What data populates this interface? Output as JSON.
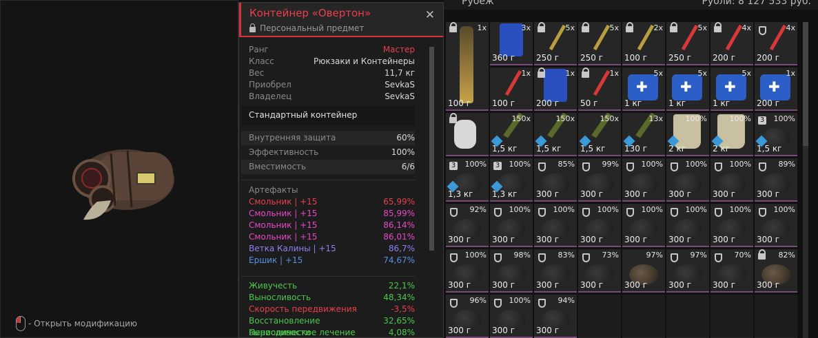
{
  "header": {
    "location": "Рубеж",
    "money": "Рубли: 8 127 533 руб."
  },
  "hint": {
    "text": "- Открыть модификацию"
  },
  "panel": {
    "title": "Контейнер «Овертон»",
    "subtitle": "Персональный предмет",
    "close": "✕",
    "info": [
      {
        "k": "Ранг",
        "v": "Мастер",
        "color": "#e8404c"
      },
      {
        "k": "Класс",
        "v": "Рюкзаки и Контейнеры"
      },
      {
        "k": "Вес",
        "v": "11,7 кг"
      },
      {
        "k": "Приобрел",
        "v": "SevkaS"
      },
      {
        "k": "Владелец",
        "v": "SevkaS"
      }
    ],
    "container_type": "Стандартный контейнер",
    "stats": [
      {
        "k": "Внутренняя защита",
        "v": "60%"
      },
      {
        "k": "Эффективность",
        "v": "100%"
      },
      {
        "k": "Вместимость",
        "v": "6/6"
      }
    ],
    "artifacts_header": "Артефакты",
    "artifacts": [
      {
        "k": "Смольник | +15",
        "v": "65,99%",
        "color": "#e8404c"
      },
      {
        "k": "Смольник | +15",
        "v": "85,99%",
        "color": "#e848c8"
      },
      {
        "k": "Смольник | +15",
        "v": "86,14%",
        "color": "#e848c8"
      },
      {
        "k": "Смольник | +15",
        "v": "86,01%",
        "color": "#e848c8"
      },
      {
        "k": "Ветка Калины | +15",
        "v": "86,7%",
        "color": "#8a82f0"
      },
      {
        "k": "Ершик | +15",
        "v": "74,67%",
        "color": "#5a90e8"
      }
    ],
    "effects": [
      {
        "k": "Живучесть",
        "v": "22,1%",
        "color": "#4cc84c"
      },
      {
        "k": "Выносливость",
        "v": "48,34%",
        "color": "#4cc84c"
      },
      {
        "k": "Скорость передвижения",
        "v": "-3,5%",
        "color": "#e8404c"
      },
      {
        "k": "Восстановление выносливости",
        "v": "32,65%",
        "color": "#4cc84c"
      },
      {
        "k": "Периодическое лечение",
        "v": "4,08%",
        "color": "#4cc84c"
      }
    ]
  },
  "inventory": {
    "cells": [
      {
        "c": "1x",
        "w": "100 г",
        "m": "lock",
        "a": "bottle"
      },
      {
        "c": "3x",
        "w": "360 г",
        "m": "",
        "a": "can"
      },
      {
        "c": "5x",
        "w": "250 г",
        "m": "lock",
        "a": "stick"
      },
      {
        "c": "5x",
        "w": "250 г",
        "m": "lock",
        "a": "stick"
      },
      {
        "c": "2x",
        "w": "100 г",
        "m": "lock",
        "a": "stick"
      },
      {
        "c": "5x",
        "w": "250 г",
        "m": "lock",
        "a": "stick-red"
      },
      {
        "c": "4x",
        "w": "200 г",
        "m": "lock",
        "a": "stick-red"
      },
      {
        "c": "4x",
        "w": "200 г",
        "m": "shield",
        "a": "stick-red"
      },
      {
        "c": "",
        "w": "",
        "m": "",
        "a": "skip"
      },
      {
        "c": "1x",
        "w": "100 г",
        "m": "",
        "a": "stick-red"
      },
      {
        "c": "1x",
        "w": "200 г",
        "m": "lock",
        "a": "can"
      },
      {
        "c": "1x",
        "w": "50 г",
        "m": "lock",
        "a": "stick-red"
      },
      {
        "c": "5x",
        "w": "1 кг",
        "m": "",
        "a": "medkit"
      },
      {
        "c": "5x",
        "w": "1 кг",
        "m": "",
        "a": "medkit"
      },
      {
        "c": "5x",
        "w": "1 кг",
        "m": "",
        "a": "medkit"
      },
      {
        "c": "1x",
        "w": "200 г",
        "m": "",
        "a": "medkit"
      },
      {
        "c": "",
        "w": "",
        "m": "lock",
        "a": "dogtag"
      },
      {
        "c": "150x",
        "w": "1,5 кг",
        "m": "",
        "a": "ammo"
      },
      {
        "c": "150x",
        "w": "1,5 кг",
        "m": "",
        "a": "ammo"
      },
      {
        "c": "150x",
        "w": "1,5 кг",
        "m": "",
        "a": "ammo"
      },
      {
        "c": "13x",
        "w": "130 г",
        "m": "",
        "a": "ammo"
      },
      {
        "c": "100%",
        "w": "2 кг",
        "m": "",
        "a": "plate"
      },
      {
        "c": "100%",
        "w": "2 кг",
        "m": "",
        "a": "plate"
      },
      {
        "c": "100%",
        "w": "1,5 кг",
        "m": "sq",
        "a": "art"
      },
      {
        "c": "100%",
        "w": "1,3 кг",
        "m": "sq",
        "a": "art"
      },
      {
        "c": "100%",
        "w": "1,3 кг",
        "m": "sq",
        "a": "art"
      },
      {
        "c": "85%",
        "w": "300 г",
        "m": "shield",
        "a": "art"
      },
      {
        "c": "99%",
        "w": "300 г",
        "m": "shield",
        "a": "art"
      },
      {
        "c": "100%",
        "w": "300 г",
        "m": "shield",
        "a": "art"
      },
      {
        "c": "100%",
        "w": "300 г",
        "m": "shield",
        "a": "art"
      },
      {
        "c": "100%",
        "w": "300 г",
        "m": "shield",
        "a": "art"
      },
      {
        "c": "89%",
        "w": "300 г",
        "m": "shield",
        "a": "art"
      },
      {
        "c": "92%",
        "w": "300 г",
        "m": "shield",
        "a": "art"
      },
      {
        "c": "100%",
        "w": "300 г",
        "m": "shield",
        "a": "art"
      },
      {
        "c": "100%",
        "w": "300 г",
        "m": "shield",
        "a": "art"
      },
      {
        "c": "100%",
        "w": "300 г",
        "m": "shield",
        "a": "art"
      },
      {
        "c": "100%",
        "w": "300 г",
        "m": "shield",
        "a": "art"
      },
      {
        "c": "100%",
        "w": "300 г",
        "m": "shield",
        "a": "art"
      },
      {
        "c": "100%",
        "w": "300 г",
        "m": "shield",
        "a": "art"
      },
      {
        "c": "100%",
        "w": "300 г",
        "m": "shield",
        "a": "art"
      },
      {
        "c": "100%",
        "w": "300 г",
        "m": "shield",
        "a": "art"
      },
      {
        "c": "98%",
        "w": "300 г",
        "m": "shield",
        "a": "art"
      },
      {
        "c": "83%",
        "w": "300 г",
        "m": "shield",
        "a": "art"
      },
      {
        "c": "73%",
        "w": "300 г",
        "m": "shield",
        "a": "art"
      },
      {
        "c": "97%",
        "w": "300 г",
        "m": "",
        "a": "art2"
      },
      {
        "c": "97%",
        "w": "300 г",
        "m": "shield",
        "a": "art"
      },
      {
        "c": "70%",
        "w": "300 г",
        "m": "shield",
        "a": "art"
      },
      {
        "c": "82%",
        "w": "300 г",
        "m": "lock",
        "a": "art2"
      },
      {
        "c": "96%",
        "w": "300 г",
        "m": "shield",
        "a": "art"
      },
      {
        "c": "100%",
        "w": "300 г",
        "m": "shield",
        "a": "art"
      },
      {
        "c": "94%",
        "w": "300 г",
        "m": "shield",
        "a": "art"
      },
      {
        "c": "",
        "w": "",
        "m": "",
        "a": "empty"
      },
      {
        "c": "",
        "w": "",
        "m": "",
        "a": "empty"
      },
      {
        "c": "",
        "w": "",
        "m": "",
        "a": "empty"
      },
      {
        "c": "",
        "w": "",
        "m": "",
        "a": "empty"
      },
      {
        "c": "",
        "w": "",
        "m": "",
        "a": "empty"
      }
    ],
    "square_badge": "3",
    "lock_count_badge": "6"
  }
}
